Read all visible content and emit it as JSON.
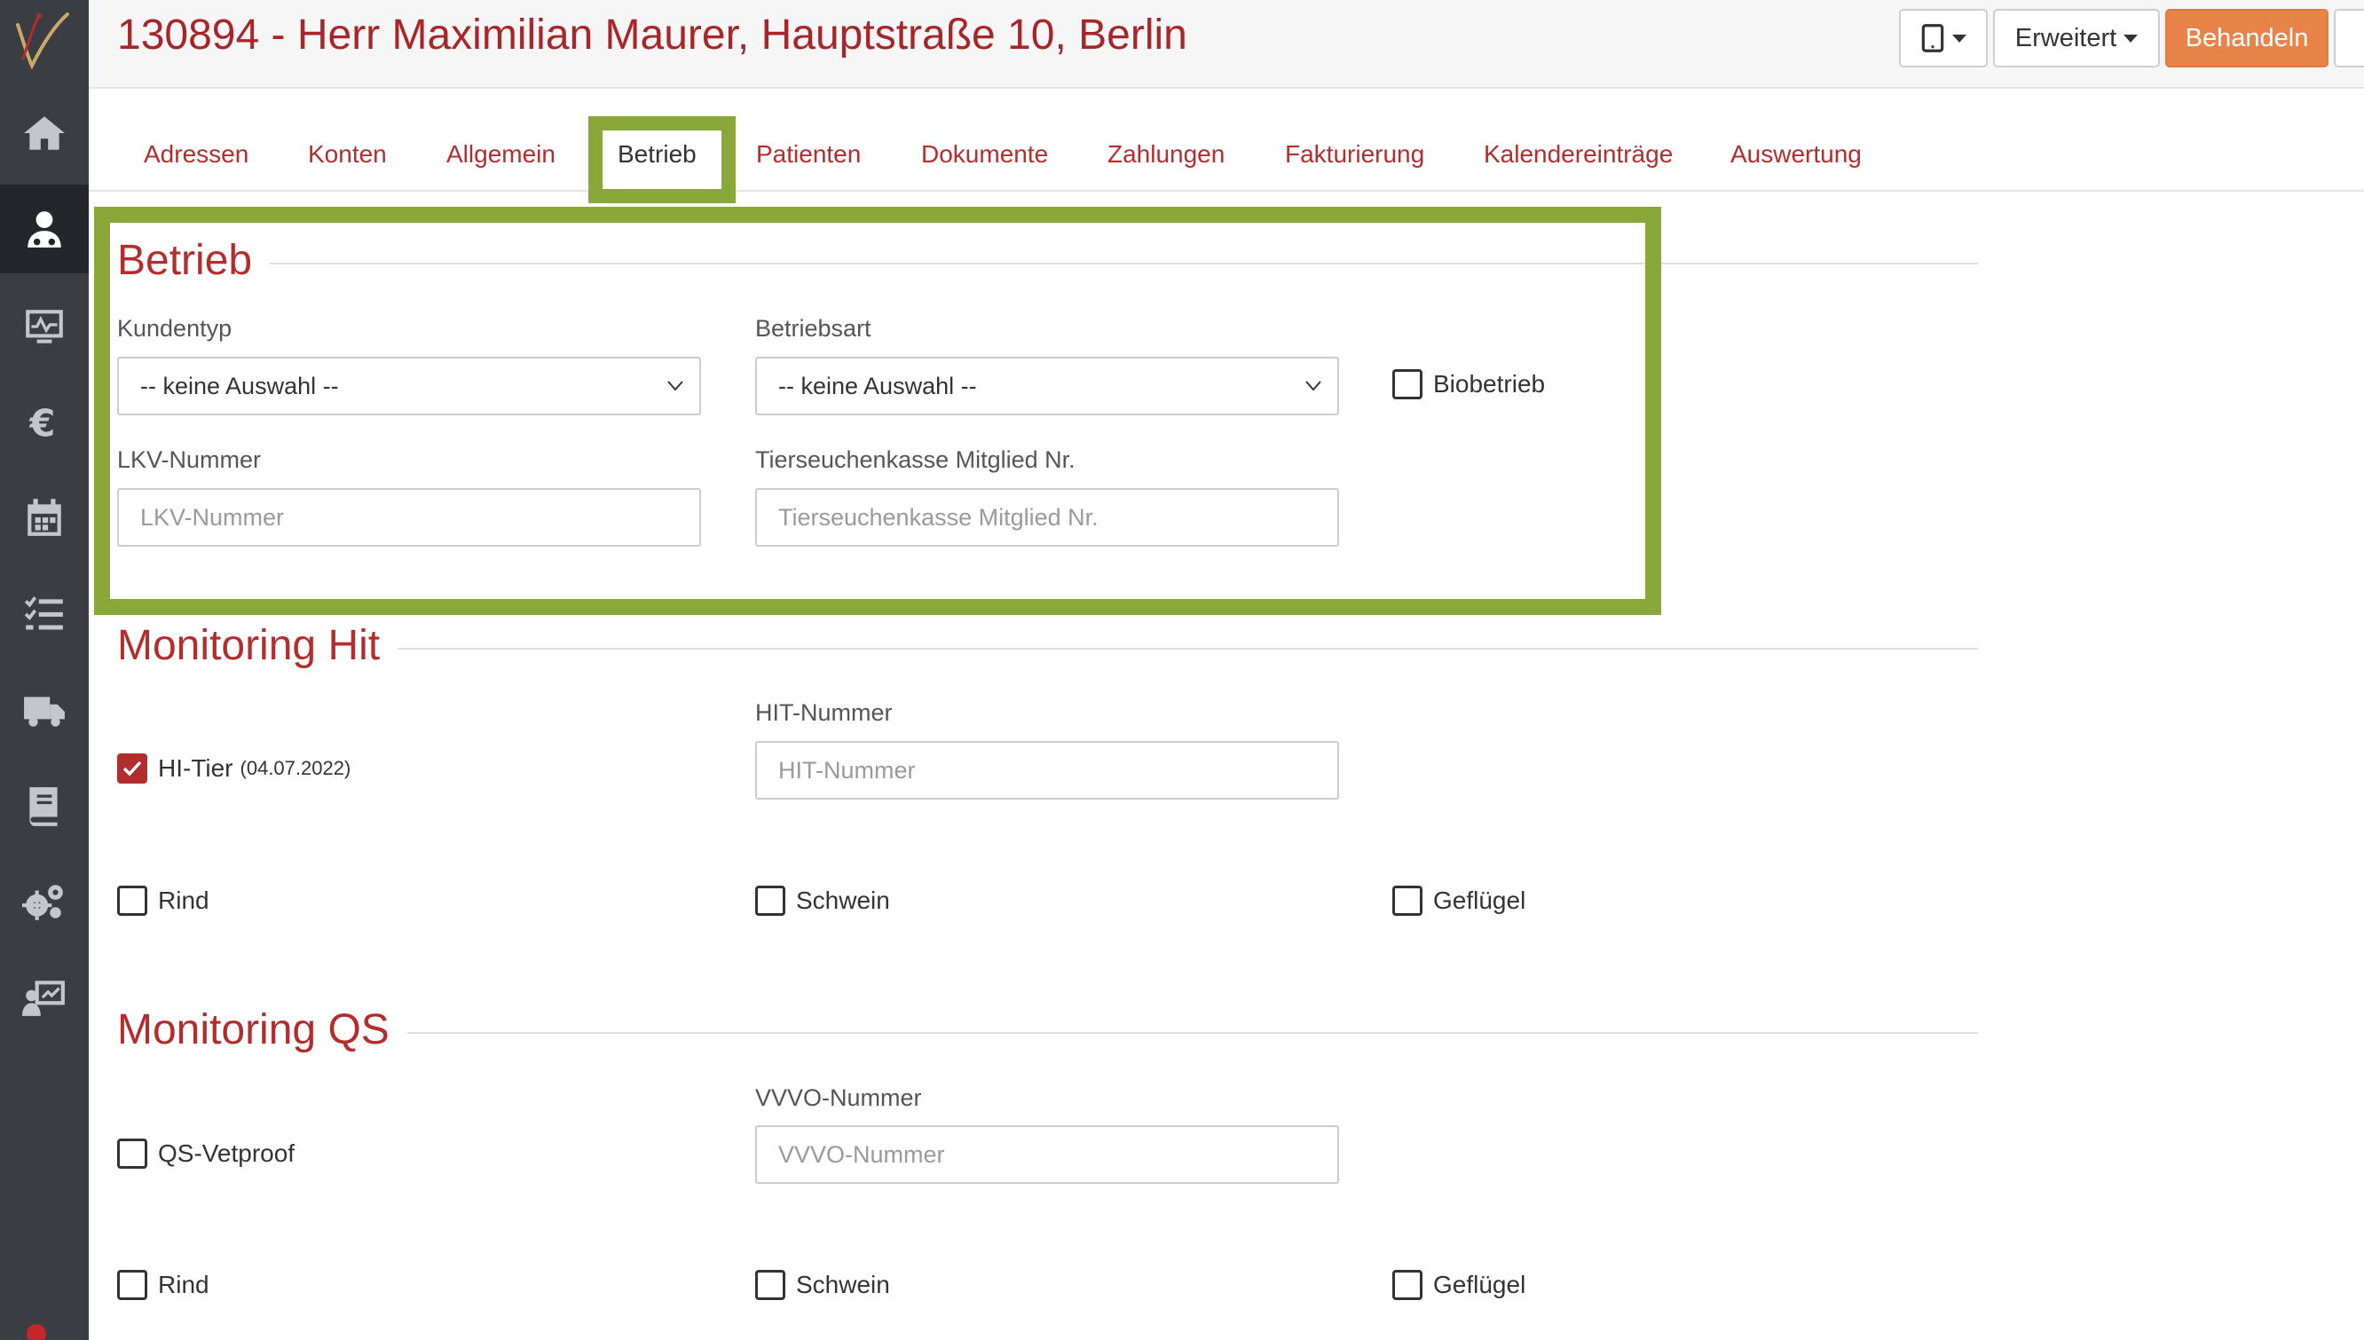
{
  "colors": {
    "brand_red": "#b32d2f",
    "accent_orange": "#e8844a",
    "sidebar_bg": "#3a3d42",
    "highlight_green": "#8aa83a"
  },
  "header": {
    "title": "130894 - Herr Maximilian Maurer, Hauptstraße 10, Berlin",
    "device_button_icon": "tablet-icon",
    "erweitert_label": "Erweitert",
    "behandeln_label": "Behandeln"
  },
  "sidebar": {
    "items": [
      {
        "icon": "home-icon"
      },
      {
        "icon": "customer-icon",
        "active": true
      },
      {
        "icon": "monitor-chart-icon"
      },
      {
        "icon": "euro-icon"
      },
      {
        "icon": "calendar-icon"
      },
      {
        "icon": "checklist-icon"
      },
      {
        "icon": "truck-icon"
      },
      {
        "icon": "book-icon"
      },
      {
        "icon": "gears-icon"
      },
      {
        "icon": "presentation-icon"
      }
    ]
  },
  "tabs": [
    {
      "label": "Adressen"
    },
    {
      "label": "Konten"
    },
    {
      "label": "Allgemein"
    },
    {
      "label": "Betrieb",
      "active": true
    },
    {
      "label": "Patienten"
    },
    {
      "label": "Dokumente"
    },
    {
      "label": "Zahlungen"
    },
    {
      "label": "Fakturierung"
    },
    {
      "label": "Kalendereinträge"
    },
    {
      "label": "Auswertung"
    }
  ],
  "betrieb": {
    "title": "Betrieb",
    "kundentyp_label": "Kundentyp",
    "kundentyp_value": "-- keine Auswahl --",
    "betriebsart_label": "Betriebsart",
    "betriebsart_value": "-- keine Auswahl --",
    "biobetrieb_label": "Biobetrieb",
    "biobetrieb_checked": false,
    "lkv_label": "LKV-Nummer",
    "lkv_placeholder": "LKV-Nummer",
    "tsk_label": "Tierseuchenkasse Mitglied Nr.",
    "tsk_placeholder": "Tierseuchenkasse Mitglied Nr."
  },
  "monitoring_hit": {
    "title": "Monitoring Hit",
    "hitier_label": "HI-Tier",
    "hitier_date": "(04.07.2022)",
    "hitier_checked": true,
    "hit_nummer_label": "HIT-Nummer",
    "hit_nummer_placeholder": "HIT-Nummer",
    "rind_label": "Rind",
    "schwein_label": "Schwein",
    "gefluegel_label": "Geflügel"
  },
  "monitoring_qs": {
    "title": "Monitoring QS",
    "qs_vetproof_label": "QS-Vetproof",
    "vvvo_label": "VVVO-Nummer",
    "vvvo_placeholder": "VVVO-Nummer",
    "rind_label": "Rind",
    "schwein_label": "Schwein",
    "gefluegel_label": "Geflügel"
  }
}
